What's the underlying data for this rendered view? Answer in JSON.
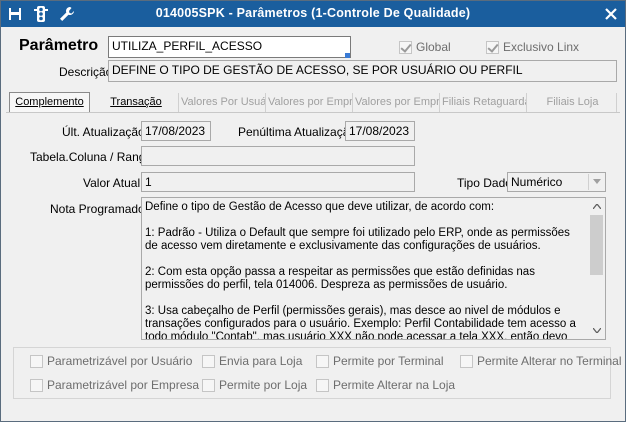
{
  "window": {
    "title": "014005SPK - Parâmetros (1-Controle De Qualidade)",
    "title_bar_color": "#1a5e9e",
    "toolbar_icons": [
      "save-icon",
      "traffic-light-icon",
      "wrench-icon"
    ],
    "close_icon": "close-icon"
  },
  "header": {
    "parametro_label": "Parâmetro",
    "parametro_value": "UTILIZA_PERFIL_ACESSO",
    "global_label": "Global",
    "global_checked": true,
    "exclusivo_label": "Exclusivo Linx",
    "exclusivo_checked": true,
    "descricao_label": "Descrição",
    "descricao_value": "DEFINE O TIPO DE GESTÃO DE ACESSO, SE POR USUÁRIO OU PERFIL"
  },
  "tabs": [
    {
      "label": "Complemento",
      "state": "active"
    },
    {
      "label": "Transação",
      "state": "enabled"
    },
    {
      "label": "Valores Por Usuário",
      "state": "disabled"
    },
    {
      "label": "Valores por Empresa",
      "state": "disabled"
    },
    {
      "label": "Valores por Empresa",
      "state": "disabled"
    },
    {
      "label": "Filiais Retaguarda",
      "state": "disabled"
    },
    {
      "label": "Filiais Loja",
      "state": "disabled"
    }
  ],
  "complemento": {
    "ult_atualizacao_label": "Últ. Atualização",
    "ult_atualizacao_value": "17/08/2023",
    "penultima_label": "Penúltima Atualização",
    "penultima_value": "17/08/2023",
    "tabela_coluna_label": "Tabela.Coluna / Range",
    "tabela_coluna_value": "",
    "valor_atual_label": "Valor Atual",
    "valor_atual_value": "1",
    "tipo_dado_label": "Tipo Dado",
    "tipo_dado_value": "Numérico",
    "nota_label": "Nota Programador",
    "nota_text": "Define o tipo de Gestão de Acesso que deve utilizar, de acordo com:\n\n1: Padrão - Utiliza o Default que sempre foi utilizado pelo ERP, onde as permissões de acesso vem diretamente e exclusivamente das configurações de usuários.\n\n2: Com esta opção passa a respeitar as permissões que estão definidas nas permissões do perfil, tela 014006. Despreza as permissões de usuário.\n\n3: Usa cabeçalho de Perfil (permissões gerais), mas desce ao nivel de módulos e transações configurados para o usuário. Exemplo: Perfil Contabilidade tem acesso a todo módulo \"Contab\", mas usuário XXX não pode acessar a tela XXX, então devo neste caso fazer o"
  },
  "options": [
    {
      "label": "Parametrizável por Usuário",
      "checked": false
    },
    {
      "label": "Envia para Loja",
      "checked": false
    },
    {
      "label": "Permite por Terminal",
      "checked": false
    },
    {
      "label": "Permite Alterar no Terminal",
      "checked": false
    },
    {
      "label": "Parametrizável por Empresa",
      "checked": false
    },
    {
      "label": "Permite por Loja",
      "checked": false
    },
    {
      "label": "Permite Alterar na Loja",
      "checked": false
    }
  ]
}
